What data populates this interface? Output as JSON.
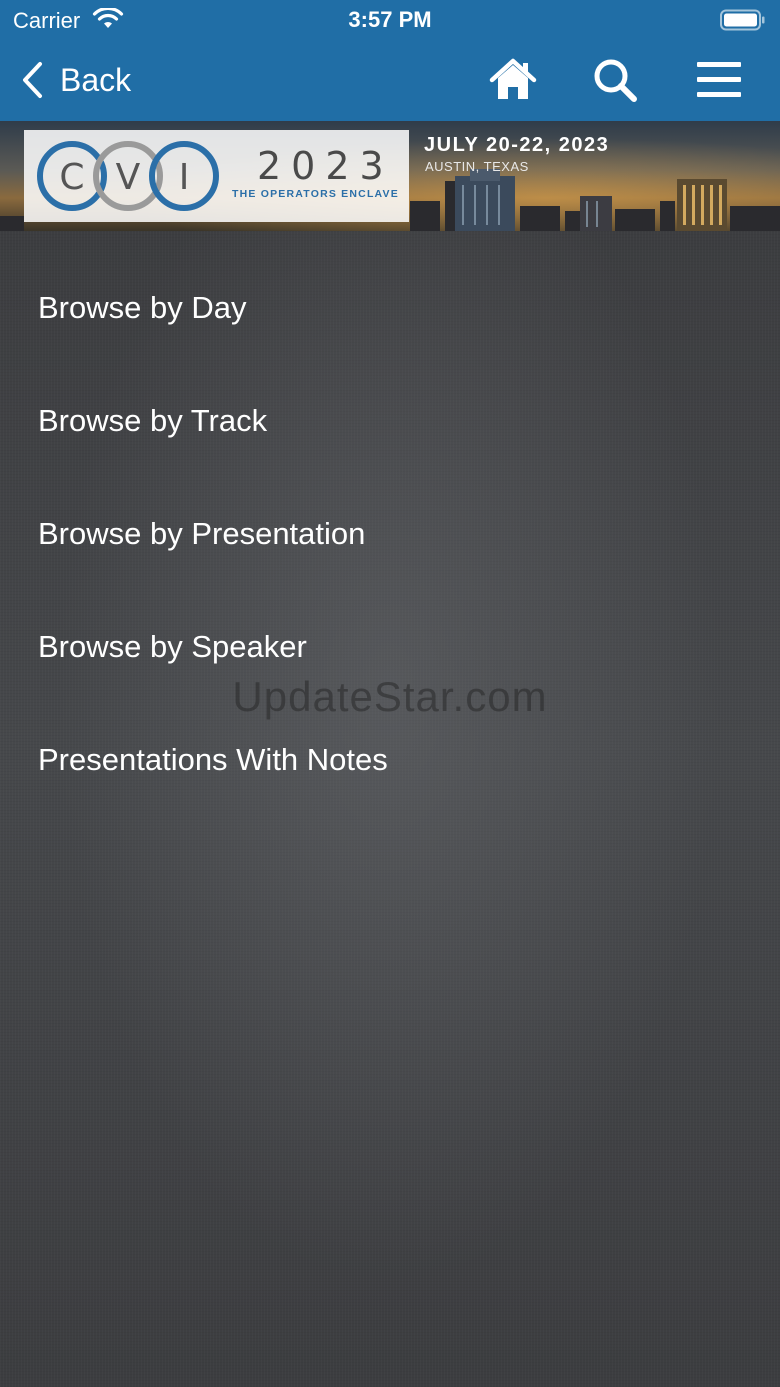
{
  "status_bar": {
    "carrier": "Carrier",
    "time": "3:57 PM"
  },
  "nav": {
    "back_label": "Back",
    "icons": [
      "home-icon",
      "search-icon",
      "hamburger-menu-icon"
    ]
  },
  "banner": {
    "logo_letters": "CVI",
    "logo_year": "2023",
    "logo_tagline": "THE OPERATORS ENCLAVE",
    "dates": "JULY 20-22, 2023",
    "location": "AUSTIN, TEXAS"
  },
  "menu": {
    "items": [
      {
        "label": "Browse by Day"
      },
      {
        "label": "Browse by Track"
      },
      {
        "label": "Browse by Presentation"
      },
      {
        "label": "Browse by Speaker"
      },
      {
        "label": "Presentations With Notes"
      }
    ]
  },
  "watermark": "UpdateStar.com",
  "colors": {
    "nav_background": "#206ea6",
    "content_background": "#3f4043",
    "text": "#ffffff",
    "logo_blue": "#2b6fa8"
  }
}
